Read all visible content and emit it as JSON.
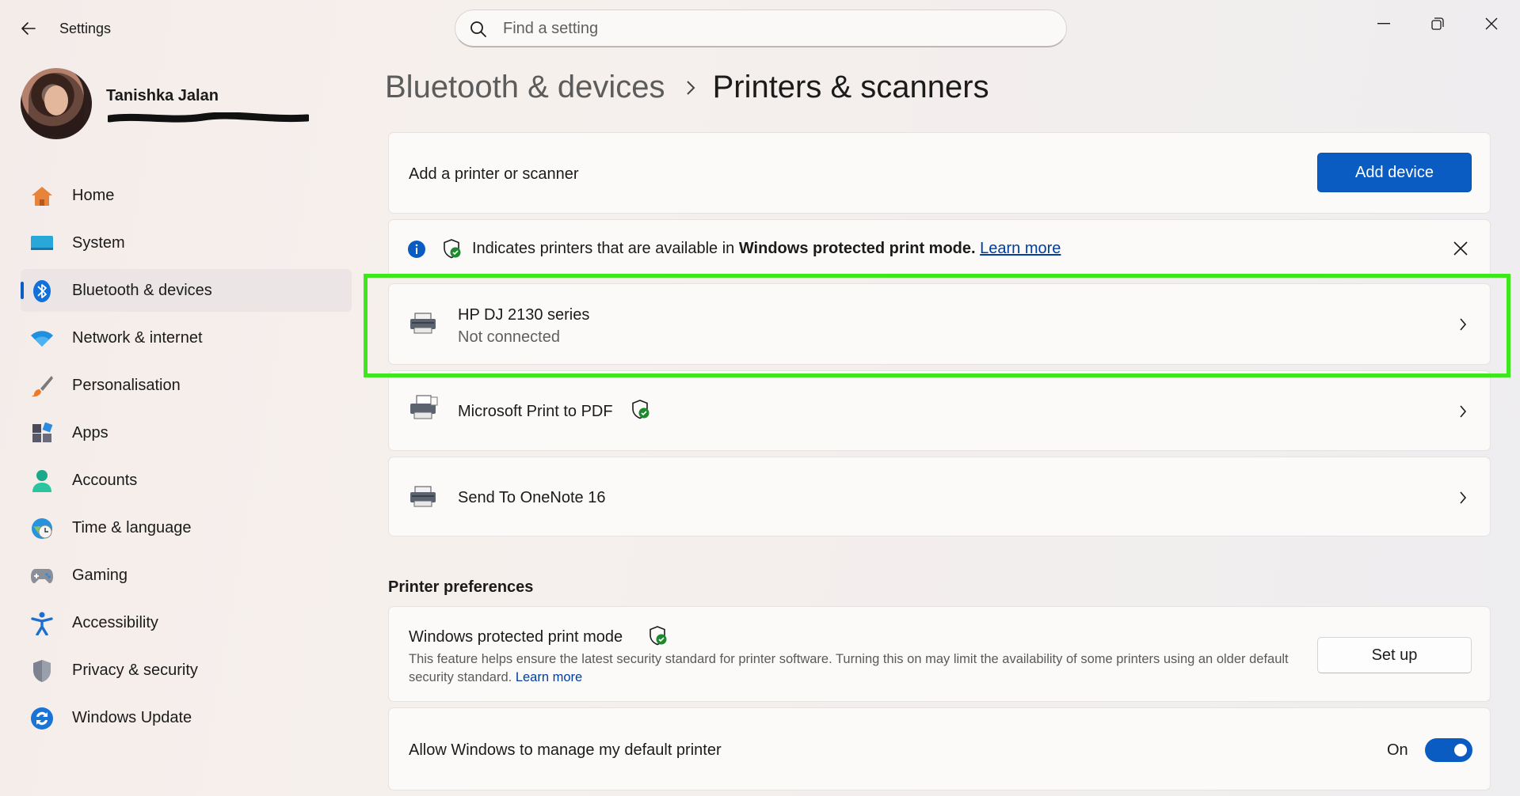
{
  "window": {
    "title": "Settings",
    "controls": {
      "minimize": "minimize-icon",
      "restore": "restore-icon",
      "close": "close-icon"
    }
  },
  "search": {
    "placeholder": "Find a setting",
    "value": ""
  },
  "profile": {
    "name": "Tanishka Jalan"
  },
  "sidebar": {
    "items": [
      {
        "label": "Home",
        "icon": "home-icon"
      },
      {
        "label": "System",
        "icon": "system-icon"
      },
      {
        "label": "Bluetooth & devices",
        "icon": "bluetooth-icon",
        "active": true
      },
      {
        "label": "Network & internet",
        "icon": "wifi-icon"
      },
      {
        "label": "Personalisation",
        "icon": "brush-icon"
      },
      {
        "label": "Apps",
        "icon": "apps-icon"
      },
      {
        "label": "Accounts",
        "icon": "accounts-icon"
      },
      {
        "label": "Time & language",
        "icon": "clock-globe-icon"
      },
      {
        "label": "Gaming",
        "icon": "gamepad-icon"
      },
      {
        "label": "Accessibility",
        "icon": "accessibility-icon"
      },
      {
        "label": "Privacy & security",
        "icon": "shield-icon"
      },
      {
        "label": "Windows Update",
        "icon": "update-icon"
      }
    ]
  },
  "breadcrumb": {
    "parent": "Bluetooth & devices",
    "current": "Printers & scanners"
  },
  "add_printer": {
    "label": "Add a printer or scanner",
    "button": "Add device"
  },
  "info_bar": {
    "text_before": "Indicates printers that are available in ",
    "text_bold": "Windows protected print mode.",
    "link": "Learn more"
  },
  "printers": [
    {
      "name": "HP DJ 2130 series",
      "status": "Not connected"
    },
    {
      "name": "Microsoft Print to PDF",
      "protected": true
    },
    {
      "name": "Send To OneNote 16"
    }
  ],
  "preferences": {
    "title": "Printer preferences",
    "protected_mode": {
      "title": "Windows protected print mode",
      "description": "This feature helps ensure the latest security standard for printer software. Turning this on may limit the availability of some printers using an older default security standard.",
      "link": "Learn more",
      "button": "Set up"
    },
    "default_printer": {
      "label": "Allow Windows to manage my default printer",
      "state": "On",
      "enabled": true
    }
  },
  "colors": {
    "accent": "#0a5cc2",
    "highlight": "#3ee61e"
  }
}
